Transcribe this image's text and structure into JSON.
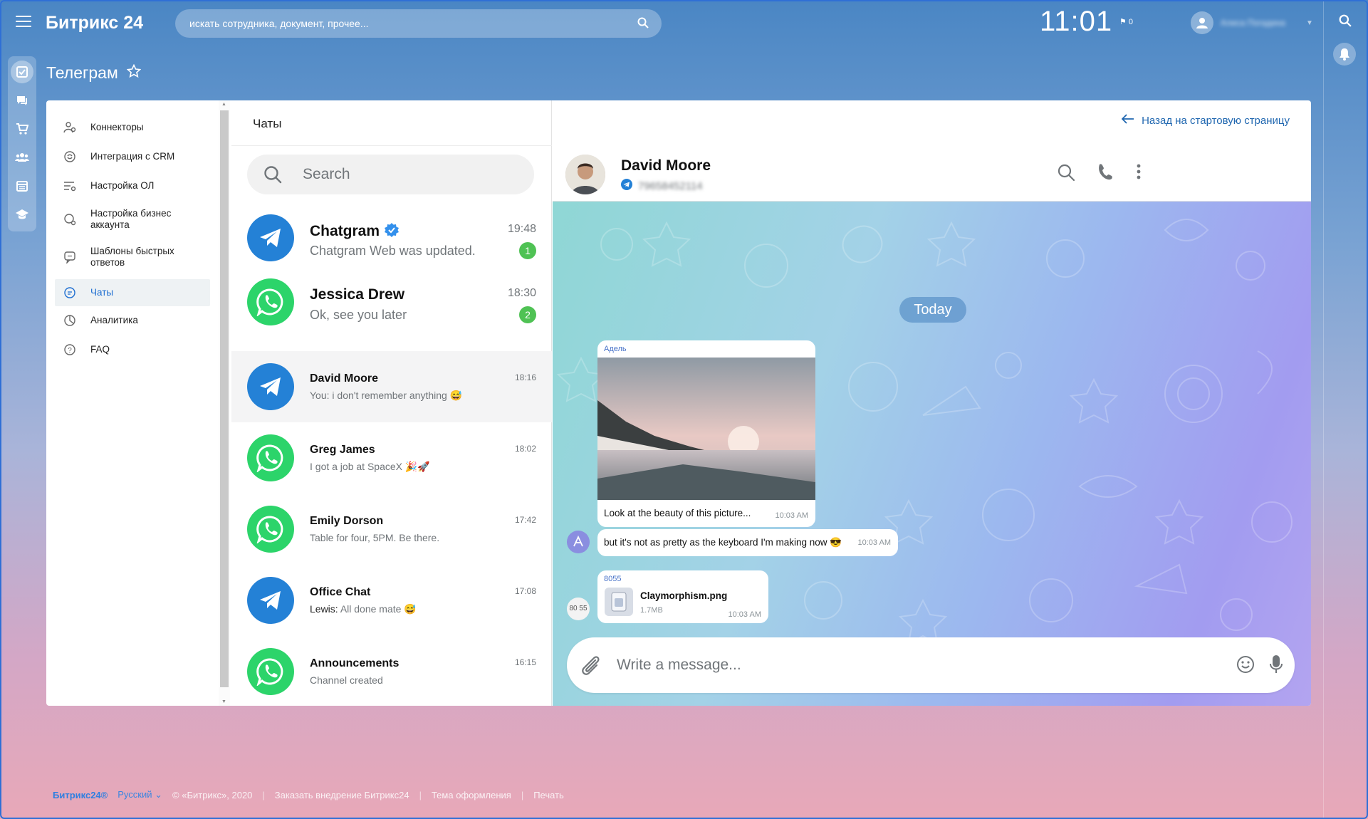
{
  "topbar": {
    "logo": "Битрикс 24",
    "search_placeholder": "искать сотрудника, документ, прочее...",
    "clock": "11:01",
    "flag_count": "0",
    "user_name": "Алиса Погадина"
  },
  "page": {
    "title": "Телеграм"
  },
  "nav": {
    "items": [
      {
        "label": "Коннекторы",
        "icon": "connectors-icon"
      },
      {
        "label": "Интеграция с CRM",
        "icon": "sync-icon"
      },
      {
        "label": "Настройка ОЛ",
        "icon": "settings-list-icon"
      },
      {
        "label": "Настройка бизнес аккаунта",
        "icon": "business-account-icon"
      },
      {
        "label": "Шаблоны быстрых ответов",
        "icon": "quick-reply-icon"
      },
      {
        "label": "Чаты",
        "icon": "chat-icon",
        "active": true
      },
      {
        "label": "Аналитика",
        "icon": "analytics-icon"
      },
      {
        "label": "FAQ",
        "icon": "help-icon"
      }
    ]
  },
  "chats": {
    "title": "Чаты",
    "search_placeholder": "Search",
    "list": [
      {
        "name": "Chatgram",
        "time": "19:48",
        "preview": "Chatgram Web was updated.",
        "badge": "1",
        "type": "telegram",
        "verified": true
      },
      {
        "name": "Jessica Drew",
        "time": "18:30",
        "preview": "Ok, see you later",
        "badge": "2",
        "type": "whatsapp"
      },
      {
        "name": "David Moore",
        "time": "18:16",
        "prefix": "You:",
        "preview": "i don't remember anything 😅",
        "type": "telegram",
        "selected": true
      },
      {
        "name": "Greg James",
        "time": "18:02",
        "preview": "I got a job at SpaceX 🎉🚀",
        "type": "whatsapp"
      },
      {
        "name": "Emily Dorson",
        "time": "17:42",
        "preview": "Table for four, 5PM. Be there.",
        "type": "whatsapp"
      },
      {
        "name": "Office Chat",
        "time": "17:08",
        "prefix": "Lewis:",
        "preview": "All done mate 😅",
        "type": "telegram"
      },
      {
        "name": "Announcements",
        "time": "16:15",
        "preview": "Channel created",
        "type": "whatsapp"
      }
    ]
  },
  "conversation": {
    "back_link": "Назад на стартовую страницу",
    "contact_name": "David Moore",
    "contact_phone": "79658452114",
    "date_divider": "Today",
    "messages": [
      {
        "author": "Адель",
        "caption": "Look at the beauty of this picture...",
        "time": "10:03 AM",
        "kind": "image"
      },
      {
        "text": "but it's not as pretty as the keyboard I'm making now 😎",
        "time": "10:03 AM",
        "kind": "text"
      },
      {
        "author": "8055",
        "file_name": "Claymorphism.png",
        "file_size": "1.7MB",
        "time": "10:03 AM",
        "kind": "file",
        "sender_initials": "80 55"
      }
    ],
    "composer_placeholder": "Write a message..."
  },
  "footer": {
    "logo": "Битрикс24®",
    "language": "Русский",
    "copyright": "© «Битрикс», 2020",
    "order_link": "Заказать внедрение Битрикс24",
    "theme_link": "Тема оформления",
    "print_link": "Печать"
  },
  "colors": {
    "accent": "#2481d6",
    "whatsapp": "#2cd46a",
    "badge": "#4fc254",
    "link": "#2067b0"
  }
}
